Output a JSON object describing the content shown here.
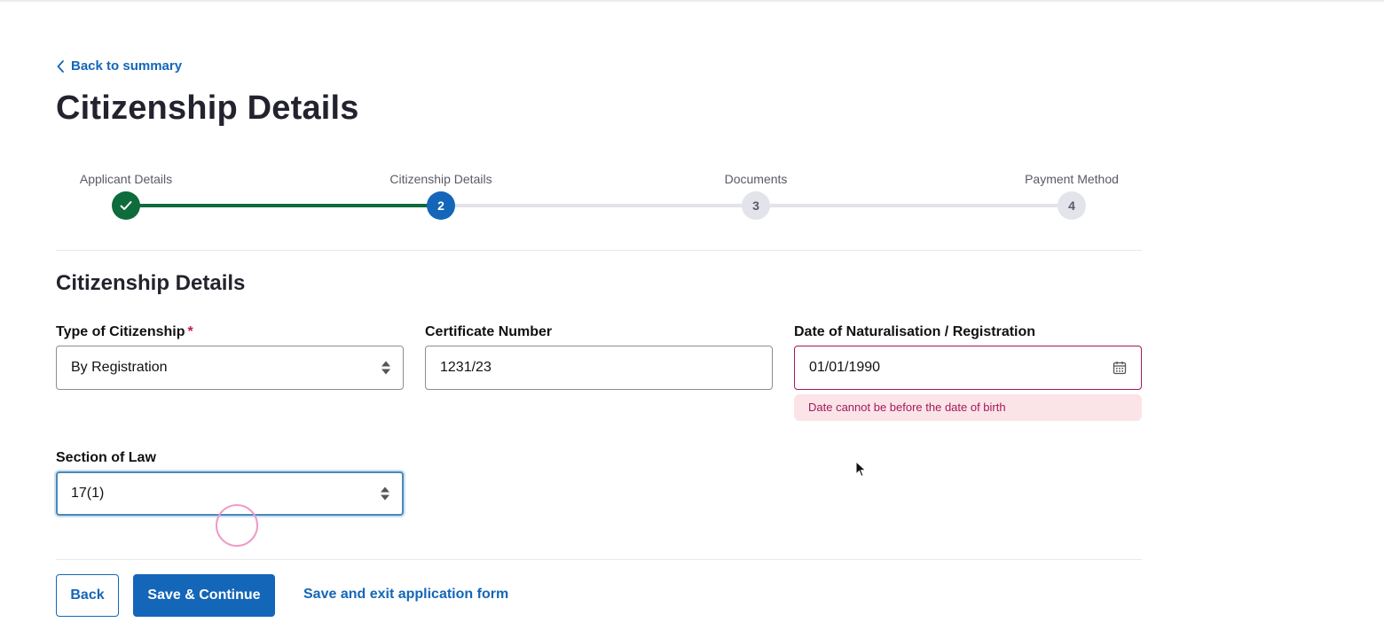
{
  "nav": {
    "back_label": "Back to summary"
  },
  "page": {
    "title": "Citizenship Details"
  },
  "stepper": {
    "steps": [
      {
        "label": "Applicant Details",
        "number": "",
        "state": "done"
      },
      {
        "label": "Citizenship Details",
        "number": "2",
        "state": "current"
      },
      {
        "label": "Documents",
        "number": "3",
        "state": "todo"
      },
      {
        "label": "Payment Method",
        "number": "4",
        "state": "todo"
      }
    ]
  },
  "section": {
    "title": "Citizenship Details"
  },
  "form": {
    "type_of_citizenship": {
      "label": "Type of Citizenship",
      "required_mark": "*",
      "value": "By Registration"
    },
    "certificate_number": {
      "label": "Certificate Number",
      "value": "1231/23"
    },
    "date_of_naturalisation": {
      "label": "Date of Naturalisation / Registration",
      "value": "01/01/1990",
      "error": "Date cannot be before the date of birth"
    },
    "section_of_law": {
      "label": "Section of Law",
      "value": "17(1)"
    }
  },
  "actions": {
    "back_label": "Back",
    "save_continue_label": "Save & Continue",
    "save_exit_label": "Save and exit application form"
  },
  "colors": {
    "primary": "#1466b8",
    "success": "#0d6b3c",
    "error": "#a3195b",
    "error_bg": "#fbe4e8"
  },
  "icons": {
    "back": "chevron-left-icon",
    "step_done": "check-icon",
    "select": "select-arrows-icon",
    "date": "calendar-icon",
    "pointer": "mouse-cursor-icon"
  }
}
